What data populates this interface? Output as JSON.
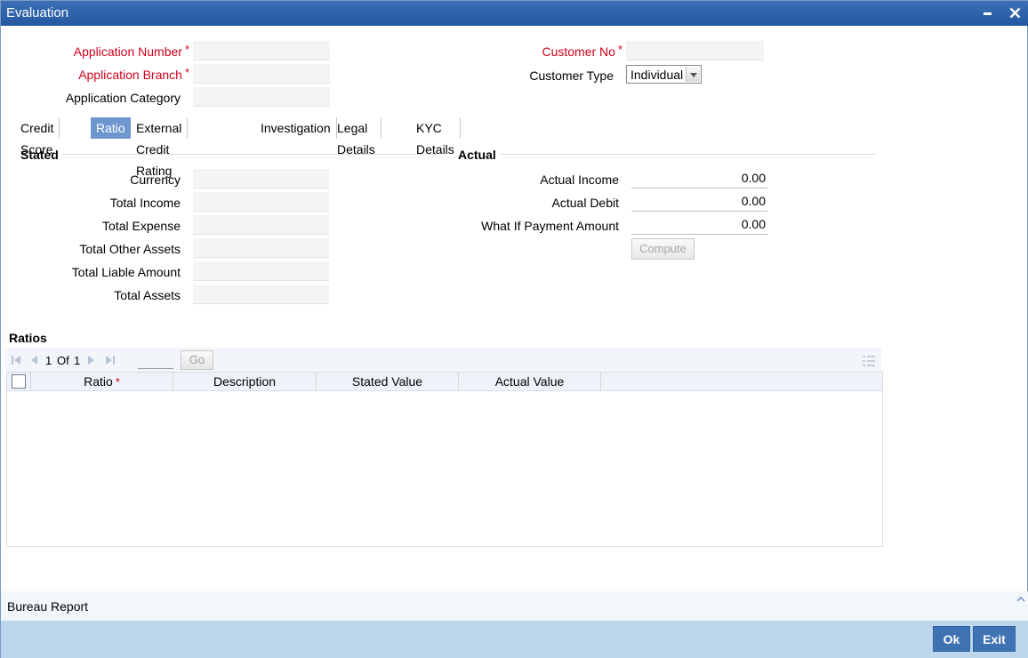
{
  "window": {
    "title": "Evaluation",
    "minimize": "‒",
    "close": "✕"
  },
  "header": {
    "application_number_label": "Application Number",
    "application_branch_label": "Application Branch",
    "application_category_label": "Application Category",
    "customer_no_label": "Customer No",
    "customer_type_label": "Customer Type",
    "customer_type_value": "Individual",
    "required_marker": "*"
  },
  "tabs": [
    {
      "label": "Credit Score"
    },
    {
      "label": "Ratio"
    },
    {
      "label": "External Credit Rating"
    },
    {
      "label": "Investigation"
    },
    {
      "label": "Legal Details"
    },
    {
      "label": "KYC Details"
    }
  ],
  "active_tab": "Ratio",
  "stated": {
    "heading": "Stated",
    "currency_label": "Currency",
    "total_income_label": "Total Income",
    "total_expense_label": "Total Expense",
    "total_other_assets_label": "Total Other Assets",
    "total_liable_amount_label": "Total Liable Amount",
    "total_assets_label": "Total Assets"
  },
  "actual": {
    "heading": "Actual",
    "actual_income_label": "Actual Income",
    "actual_income_value": "0.00",
    "actual_debit_label": "Actual Debit",
    "actual_debit_value": "0.00",
    "what_if_label": "What If Payment Amount",
    "what_if_value": "0.00",
    "compute_label": "Compute"
  },
  "ratios": {
    "heading": "Ratios",
    "pagination": {
      "current": "1",
      "of_label": "Of",
      "total": "1",
      "go_label": "Go"
    },
    "columns": [
      "Ratio",
      "Description",
      "Stated Value",
      "Actual Value"
    ],
    "rows": []
  },
  "footer": {
    "bureau_report_label": "Bureau Report",
    "ok_label": "Ok",
    "exit_label": "Exit"
  },
  "colors": {
    "title_bar": "#2b5ea6",
    "active_tab": "#6f97cf",
    "required": "#d0021b",
    "button": "#3f72b3",
    "bottom_bar": "#bdd6ee"
  }
}
